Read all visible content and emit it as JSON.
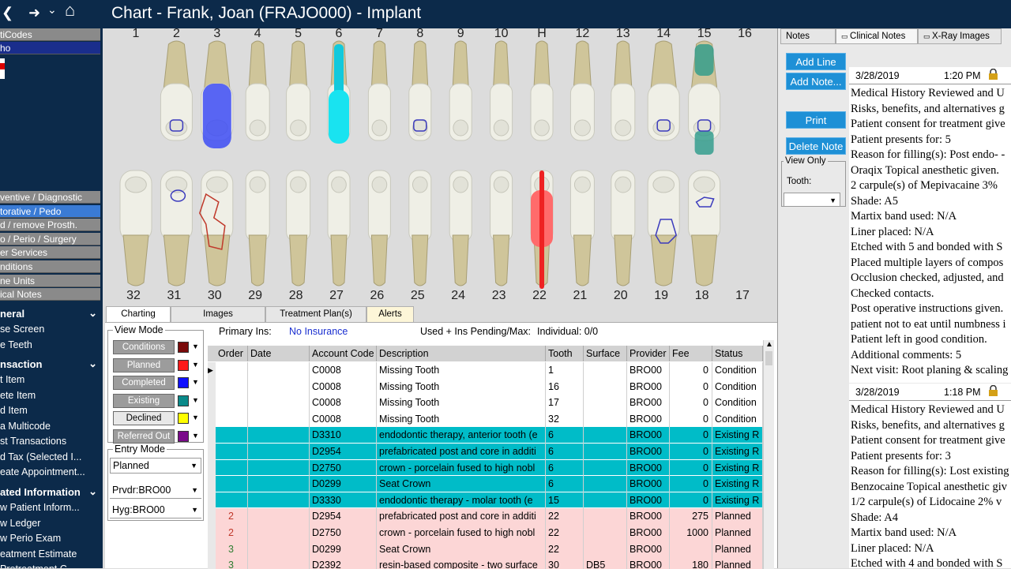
{
  "nav": {
    "back_glyph": "❮",
    "forward_glyph": "➜",
    "dropdown_glyph": "⌄",
    "home_glyph": "⌂"
  },
  "window": {
    "title": "Chart - Frank, Joan (FRAJO000)  - Implant"
  },
  "left_panel": {
    "top_items": [
      {
        "label": "tiCodes"
      },
      {
        "label": "ho"
      }
    ],
    "procedure_groups": [
      "ventive / Diagnostic",
      "torative / Pedo",
      "d / remove  Prosth.",
      "o / Perio / Surgery",
      "er Services",
      "nditions",
      "ne Units",
      "ical Notes"
    ],
    "sections": [
      {
        "title": "neral",
        "items": [
          "se Screen",
          "e Teeth"
        ]
      },
      {
        "title": "nsaction",
        "items": [
          "t Item",
          "ete Item",
          "d Item",
          "a Multicode",
          "st Transactions",
          "d Tax (Selected I...",
          "eate Appointment..."
        ]
      },
      {
        "title": "ated Information",
        "items": [
          "w Patient Inform...",
          "w Ledger",
          "w Perio Exam",
          "eatment Estimate",
          "Pretreatment C..."
        ]
      }
    ]
  },
  "chart": {
    "upper_numbers": [
      "1",
      "2",
      "3",
      "4",
      "5",
      "6",
      "7",
      "8",
      "9",
      "10",
      "H",
      "12",
      "13",
      "14",
      "15",
      "16"
    ],
    "lower_numbers": [
      "32",
      "31",
      "30",
      "29",
      "28",
      "27",
      "26",
      "25",
      "24",
      "23",
      "22",
      "21",
      "20",
      "19",
      "18",
      "17"
    ]
  },
  "tabs": [
    "Charting",
    "Images",
    "Treatment Plan(s)",
    "Alerts"
  ],
  "view_mode": {
    "legend": "View Mode",
    "buttons": [
      {
        "label": "Conditions",
        "color": "#7a0a0a"
      },
      {
        "label": "Planned",
        "color": "#ff1a1a"
      },
      {
        "label": "Completed",
        "color": "#1010ff"
      },
      {
        "label": "Existing",
        "color": "#0a8a8a"
      },
      {
        "label": "Declined",
        "color": "#ffff00"
      },
      {
        "label": "Referred Out",
        "color": "#7a0a8a"
      }
    ]
  },
  "entry_mode": {
    "legend": "Entry Mode",
    "value": "Planned",
    "prvdr": "Prvdr:BRO00",
    "hyg": "Hyg:BRO00"
  },
  "insurance": {
    "primary_label": "Primary Ins:",
    "primary_value": "No Insurance",
    "used_label": "Used + Ins Pending/Max:",
    "used_value": "Individual: 0/0"
  },
  "grid": {
    "columns": [
      "Order",
      "Date",
      "Account Code",
      "Description",
      "Tooth",
      "Surface",
      "Provider",
      "Fee",
      "Status"
    ],
    "rows": [
      {
        "order": "",
        "date": "",
        "code": "C0008",
        "desc": "Missing Tooth",
        "tooth": "1",
        "surface": "",
        "provider": "BRO00",
        "fee": "0",
        "status": "Condition",
        "style": "white"
      },
      {
        "order": "",
        "date": "",
        "code": "C0008",
        "desc": "Missing Tooth",
        "tooth": "16",
        "surface": "",
        "provider": "BRO00",
        "fee": "0",
        "status": "Condition",
        "style": "white"
      },
      {
        "order": "",
        "date": "",
        "code": "C0008",
        "desc": "Missing Tooth",
        "tooth": "17",
        "surface": "",
        "provider": "BRO00",
        "fee": "0",
        "status": "Condition",
        "style": "white"
      },
      {
        "order": "",
        "date": "",
        "code": "C0008",
        "desc": "Missing Tooth",
        "tooth": "32",
        "surface": "",
        "provider": "BRO00",
        "fee": "0",
        "status": "Condition",
        "style": "white"
      },
      {
        "order": "",
        "date": "",
        "code": "D3310",
        "desc": "endodontic therapy, anterior tooth (e",
        "tooth": "6",
        "surface": "",
        "provider": "BRO00",
        "fee": "0",
        "status": "Existing R",
        "style": "teal"
      },
      {
        "order": "",
        "date": "",
        "code": "D2954",
        "desc": "prefabricated post and core in additi",
        "tooth": "6",
        "surface": "",
        "provider": "BRO00",
        "fee": "0",
        "status": "Existing R",
        "style": "teal"
      },
      {
        "order": "",
        "date": "",
        "code": "D2750",
        "desc": "crown - porcelain fused to high nobl",
        "tooth": "6",
        "surface": "",
        "provider": "BRO00",
        "fee": "0",
        "status": "Existing R",
        "style": "teal"
      },
      {
        "order": "",
        "date": "",
        "code": "D0299",
        "desc": "Seat Crown",
        "tooth": "6",
        "surface": "",
        "provider": "BRO00",
        "fee": "0",
        "status": "Existing R",
        "style": "teal"
      },
      {
        "order": "",
        "date": "",
        "code": "D3330",
        "desc": "endodontic therapy - molar tooth (e",
        "tooth": "15",
        "surface": "",
        "provider": "BRO00",
        "fee": "0",
        "status": "Existing R",
        "style": "teal"
      },
      {
        "order": "2",
        "date": "",
        "code": "D2954",
        "desc": "prefabricated post and core in additi",
        "tooth": "22",
        "surface": "",
        "provider": "BRO00",
        "fee": "275",
        "status": "Planned",
        "style": "pink"
      },
      {
        "order": "2",
        "date": "",
        "code": "D2750",
        "desc": "crown - porcelain fused to high nobl",
        "tooth": "22",
        "surface": "",
        "provider": "BRO00",
        "fee": "1000",
        "status": "Planned",
        "style": "pink"
      },
      {
        "order": "3",
        "date": "",
        "code": "D0299",
        "desc": "Seat Crown",
        "tooth": "22",
        "surface": "",
        "provider": "BRO00",
        "fee": "",
        "status": "Planned",
        "style": "pink"
      },
      {
        "order": "3",
        "date": "",
        "code": "D2392",
        "desc": "resin-based composite - two surface",
        "tooth": "30",
        "surface": "DB5",
        "provider": "BRO00",
        "fee": "180",
        "status": "Planned",
        "style": "pink"
      }
    ]
  },
  "right_panel": {
    "tabs": [
      "Notes",
      "Clinical Notes",
      "X-Ray Images"
    ],
    "buttons": [
      "Add Line",
      "Add Note...",
      "Print",
      "Delete Note"
    ],
    "view_only": {
      "legend": "View Only",
      "tooth_label": "Tooth:"
    },
    "notes": [
      {
        "date": "3/28/2019",
        "time": "1:20 PM",
        "lines": [
          "Medical History Reviewed and U",
          "Risks, benefits, and alternatives g",
          "Patient consent for treatment give",
          "Patient presents for: 5",
          "Reason for filling(s): Post endo- -",
          "Oraqix Topical anesthetic given.",
          "2 carpule(s) of  Mepivacaine 3%",
          "Shade: A5",
          "Martix band used: N/A",
          "Liner placed: N/A",
          "Etched with 5 and bonded with S",
          "Placed multiple layers of compos",
          "Occlusion checked, adjusted, and",
          "Checked contacts.",
          "Post operative instructions given.",
          "patient not to eat until numbness i",
          "Patient left in good condition.",
          "Additional comments: 5",
          "Next visit: Root planing & scaling"
        ]
      },
      {
        "date": "3/28/2019",
        "time": "1:18 PM",
        "lines": [
          "Medical History Reviewed and U",
          "Risks, benefits, and alternatives g",
          "Patient consent for treatment give",
          "Patient presents for: 3",
          "Reason for filling(s): Lost existing",
          "Benzocaine Topical anesthetic giv",
          "1/2 carpule(s) of  Lidocaine 2% v",
          "Shade: A4",
          "Martix band used: N/A",
          "Liner placed: N/A",
          "Etched with 4 and bonded with S"
        ]
      }
    ]
  },
  "colors": {
    "navy": "#0c2a4a",
    "teal": "#00bcc8",
    "pink": "#fcd6d6",
    "accent_blue": "#1e90d6"
  }
}
